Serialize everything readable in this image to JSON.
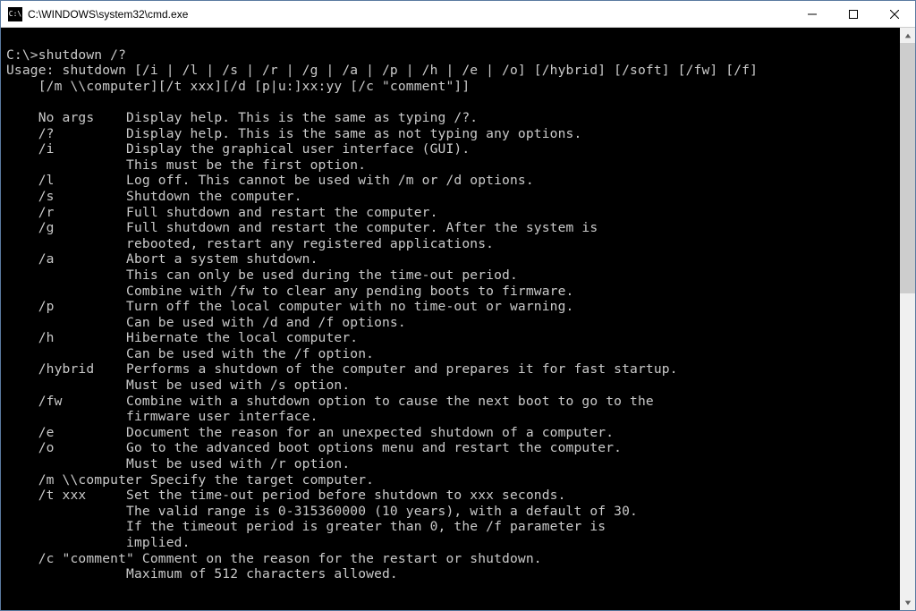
{
  "window": {
    "title": "C:\\WINDOWS\\system32\\cmd.exe",
    "icon_glyph": "C:\\"
  },
  "console": {
    "prompt_line": "C:\\>shutdown /?",
    "usage1": "Usage: shutdown [/i | /l | /s | /r | /g | /a | /p | /h | /e | /o] [/hybrid] [/soft] [/fw] [/f]",
    "usage2": "    [/m \\\\computer][/t xxx][/d [p|u:]xx:yy [/c \"comment\"]]",
    "options": [
      {
        "flag": "No args",
        "lines": [
          "Display help. This is the same as typing /?."
        ]
      },
      {
        "flag": "/?",
        "lines": [
          "Display help. This is the same as not typing any options."
        ]
      },
      {
        "flag": "/i",
        "lines": [
          "Display the graphical user interface (GUI).",
          "This must be the first option."
        ]
      },
      {
        "flag": "/l",
        "lines": [
          "Log off. This cannot be used with /m or /d options."
        ]
      },
      {
        "flag": "/s",
        "lines": [
          "Shutdown the computer."
        ]
      },
      {
        "flag": "/r",
        "lines": [
          "Full shutdown and restart the computer."
        ]
      },
      {
        "flag": "/g",
        "lines": [
          "Full shutdown and restart the computer. After the system is",
          "rebooted, restart any registered applications."
        ]
      },
      {
        "flag": "/a",
        "lines": [
          "Abort a system shutdown.",
          "This can only be used during the time-out period.",
          "Combine with /fw to clear any pending boots to firmware."
        ]
      },
      {
        "flag": "/p",
        "lines": [
          "Turn off the local computer with no time-out or warning.",
          "Can be used with /d and /f options."
        ]
      },
      {
        "flag": "/h",
        "lines": [
          "Hibernate the local computer.",
          "Can be used with the /f option."
        ]
      },
      {
        "flag": "/hybrid",
        "lines": [
          "Performs a shutdown of the computer and prepares it for fast startup.",
          "Must be used with /s option."
        ]
      },
      {
        "flag": "/fw",
        "lines": [
          "Combine with a shutdown option to cause the next boot to go to the",
          "firmware user interface."
        ]
      },
      {
        "flag": "/e",
        "lines": [
          "Document the reason for an unexpected shutdown of a computer."
        ]
      },
      {
        "flag": "/o",
        "lines": [
          "Go to the advanced boot options menu and restart the computer.",
          "Must be used with /r option."
        ]
      },
      {
        "flag": "/m \\\\computer",
        "lines": [
          "Specify the target computer."
        ],
        "nosep": true
      },
      {
        "flag": "/t xxx",
        "lines": [
          "Set the time-out period before shutdown to xxx seconds.",
          "The valid range is 0-315360000 (10 years), with a default of 30.",
          "If the timeout period is greater than 0, the /f parameter is",
          "implied."
        ]
      },
      {
        "flag": "/c \"comment\"",
        "lines": [
          "Comment on the reason for the restart or shutdown.",
          "Maximum of 512 characters allowed."
        ],
        "nosep": true
      }
    ]
  }
}
